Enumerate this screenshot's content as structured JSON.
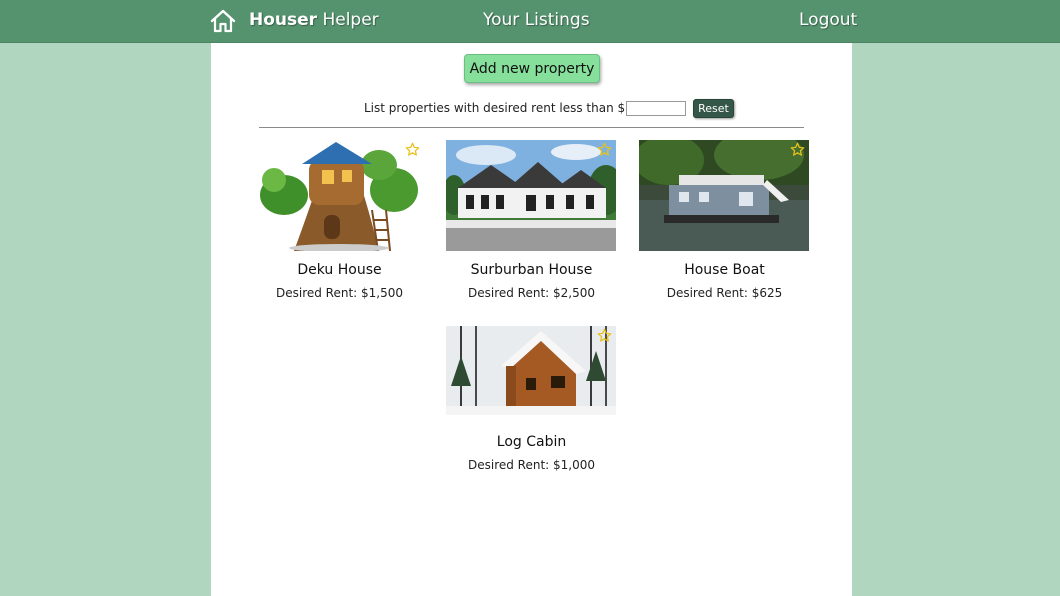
{
  "header": {
    "brand_bold": "Houser",
    "brand_rest": " Helper",
    "nav_listings": "Your Listings",
    "nav_logout": "Logout"
  },
  "actions": {
    "add_label": "Add new property"
  },
  "filter": {
    "label": "List properties with desired rent less than $",
    "value": "",
    "reset_label": "Reset"
  },
  "listings": [
    {
      "name": "Deku House",
      "rent": "Desired Rent: $1,500",
      "favorite_icon": "star-outline"
    },
    {
      "name": "Surburban House",
      "rent": "Desired Rent: $2,500",
      "favorite_icon": "star-outline"
    },
    {
      "name": "House Boat",
      "rent": "Desired Rent: $625",
      "favorite_icon": "star-outline"
    },
    {
      "name": "Log Cabin",
      "rent": "Desired Rent: $1,000",
      "favorite_icon": "star-outline"
    }
  ],
  "colors": {
    "page_bg": "#b0d6c0",
    "header_bg": "#55936f",
    "add_button": "#86df9a",
    "reset_button": "#34574a",
    "star": "#e8c21a"
  }
}
